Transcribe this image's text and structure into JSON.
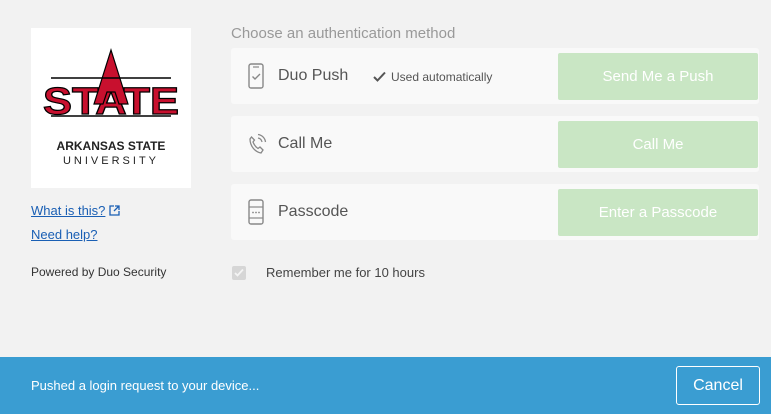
{
  "brand": {
    "logo_word": "STATE",
    "university_line1": "ARKANSAS STATE",
    "university_line2": "UNIVERSITY",
    "color_red": "#c8102e"
  },
  "sidebar": {
    "what_is_this": "What is this?",
    "need_help": "Need help?",
    "powered_by": "Powered by Duo Security"
  },
  "main": {
    "heading": "Choose an authentication method",
    "methods": [
      {
        "label": "Duo Push",
        "note": "Used automatically",
        "button": "Send Me a Push",
        "icon": "phone-check-icon"
      },
      {
        "label": "Call Me",
        "button": "Call Me",
        "icon": "phone-ringing-icon"
      },
      {
        "label": "Passcode",
        "button": "Enter a Passcode",
        "icon": "passcode-device-icon"
      }
    ],
    "remember": {
      "label": "Remember me for 10 hours",
      "checked": true
    }
  },
  "footer": {
    "status": "Pushed a login request to your device...",
    "cancel": "Cancel",
    "color": "#3a9dd2"
  },
  "colors": {
    "button_disabled_green": "#c9e6c4",
    "link_blue": "#1a5fb4"
  }
}
